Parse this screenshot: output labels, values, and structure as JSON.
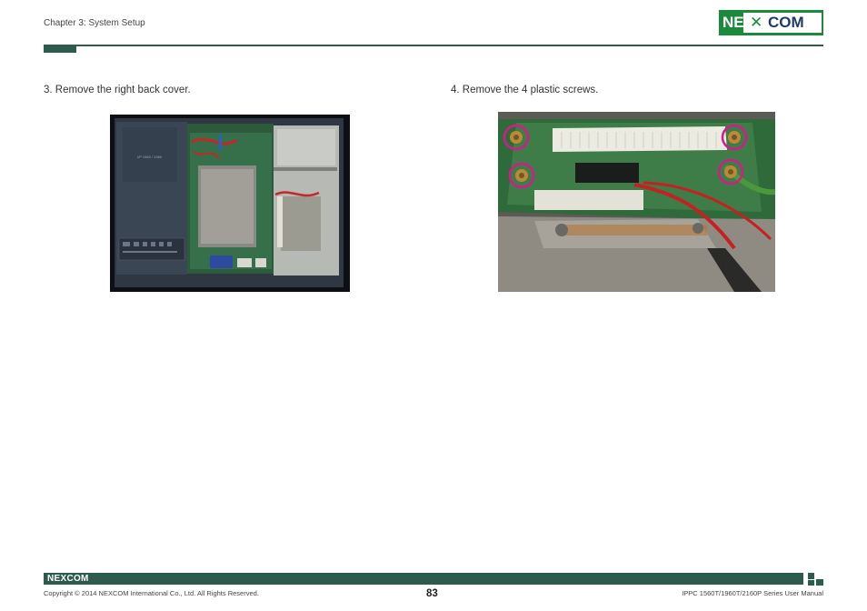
{
  "header": {
    "chapter": "Chapter 3: System Setup",
    "logo_text": "NEXCOM"
  },
  "steps": [
    {
      "text": "3. Remove the right back cover."
    },
    {
      "text": "4. Remove the 4 plastic screws."
    }
  ],
  "images": [
    {
      "description": "photo-right-back-cover-removed"
    },
    {
      "description": "photo-4-plastic-screws-circled"
    }
  ],
  "footer": {
    "logo_text": "NEXCOM",
    "copyright": "Copyright © 2014 NEXCOM International Co., Ltd. All Rights Reserved.",
    "page_number": "83",
    "manual_title": "IPPC 1560T/1960T/2160P Series User Manual"
  },
  "colors": {
    "brand_green": "#1c8a3c",
    "rule_dark_green": "#2d5b4e",
    "highlight_magenta": "#d61a8a"
  }
}
